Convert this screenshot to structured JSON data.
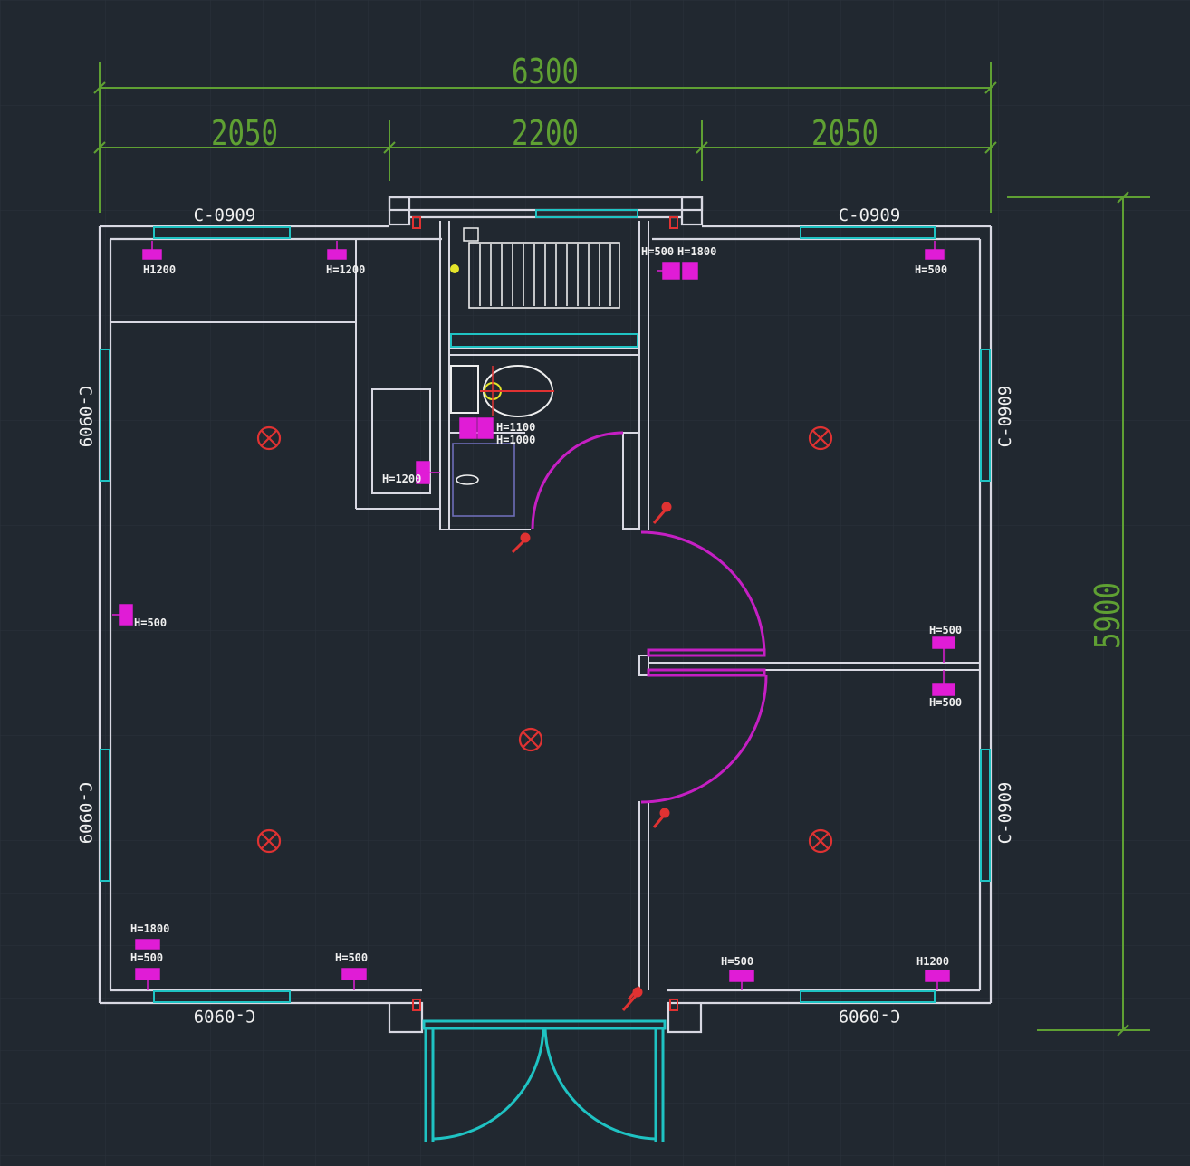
{
  "colors": {
    "background": "#212830",
    "grid": "#2c343d",
    "wall": "#d8d8e2",
    "dimension": "#5fa033",
    "window": "#1fc3c3",
    "door": "#c51fc3",
    "outlet": "#e01cd6",
    "light": "#e03232",
    "fixture": "#eeeeee",
    "text": "#f0f0f0"
  },
  "dimensions": {
    "total_width": "6300",
    "left_width": "2050",
    "middle_width": "2200",
    "right_width": "2050",
    "total_depth": "5900"
  },
  "windows": {
    "top_left": "C-0909",
    "top_right": "C-0909",
    "bottom_left": "C-0909",
    "bottom_right": "C-0909",
    "left_upper": "C-0909",
    "left_lower": "C-0909",
    "right_upper": "C-0909",
    "right_lower": "C-0909"
  },
  "outlet_labels": {
    "top_left_a": "H1200",
    "top_left_b": "H=1200",
    "top_mid_a": "H=500",
    "top_mid_b": "H=1800",
    "top_right": "H=500",
    "left_middle": "H=500",
    "desk": "H=1200",
    "bath_a": "H=1100",
    "bath_b": "H=1000",
    "right_wall_a": "H=500",
    "right_wall_b": "H=500",
    "bottom_left_a": "H=1800",
    "bottom_left_b": "H=500",
    "bottom_mid_left": "H=500",
    "bottom_mid_right": "H=500",
    "bottom_right": "H1200"
  },
  "icons": {
    "ceiling_light": "ceiling-light-icon",
    "wall_switch": "wall-switch-icon",
    "power_outlet": "power-outlet-icon",
    "toilet": "toilet-icon",
    "sink": "sink-icon",
    "shower_grate": "shower-grate-icon"
  }
}
